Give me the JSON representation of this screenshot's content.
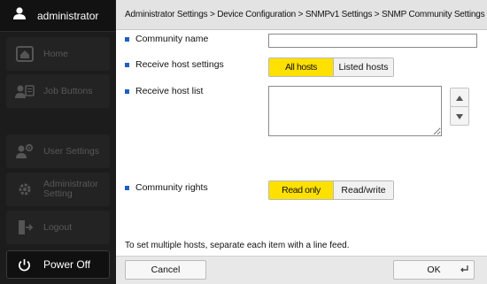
{
  "sidebar": {
    "user": {
      "name": "administrator",
      "icon": "user-icon"
    },
    "items": [
      {
        "label": "Home",
        "icon": "home-icon"
      },
      {
        "label": "Job Buttons",
        "icon": "job-buttons-icon"
      },
      {
        "label": "User Settings",
        "icon": "user-settings-icon"
      },
      {
        "label": "Administrator\nSetting",
        "icon": "admin-settings-icon"
      },
      {
        "label": "Logout",
        "icon": "logout-icon"
      }
    ],
    "power": {
      "label": "Power Off",
      "icon": "power-icon"
    }
  },
  "breadcrumb": "Administrator Settings > Device Configuration > SNMPv1 Settings > SNMP Community Settings > New",
  "form": {
    "community_name": {
      "label": "Community name",
      "value": ""
    },
    "receive_host_settings": {
      "label": "Receive host settings",
      "options": [
        "All hosts",
        "Listed hosts"
      ],
      "selected": "All hosts"
    },
    "receive_host_list": {
      "label": "Receive host list",
      "value": ""
    },
    "community_rights": {
      "label": "Community rights",
      "options": [
        "Read only",
        "Read/write"
      ],
      "selected": "Read only"
    },
    "hint": "To set multiple hosts, separate each item with a line feed."
  },
  "footer": {
    "cancel_label": "Cancel",
    "ok_label": "OK"
  },
  "colors": {
    "selected": "#ffe100",
    "bullet": "#1f5fbf",
    "sidebar": "#1c1c1c"
  }
}
